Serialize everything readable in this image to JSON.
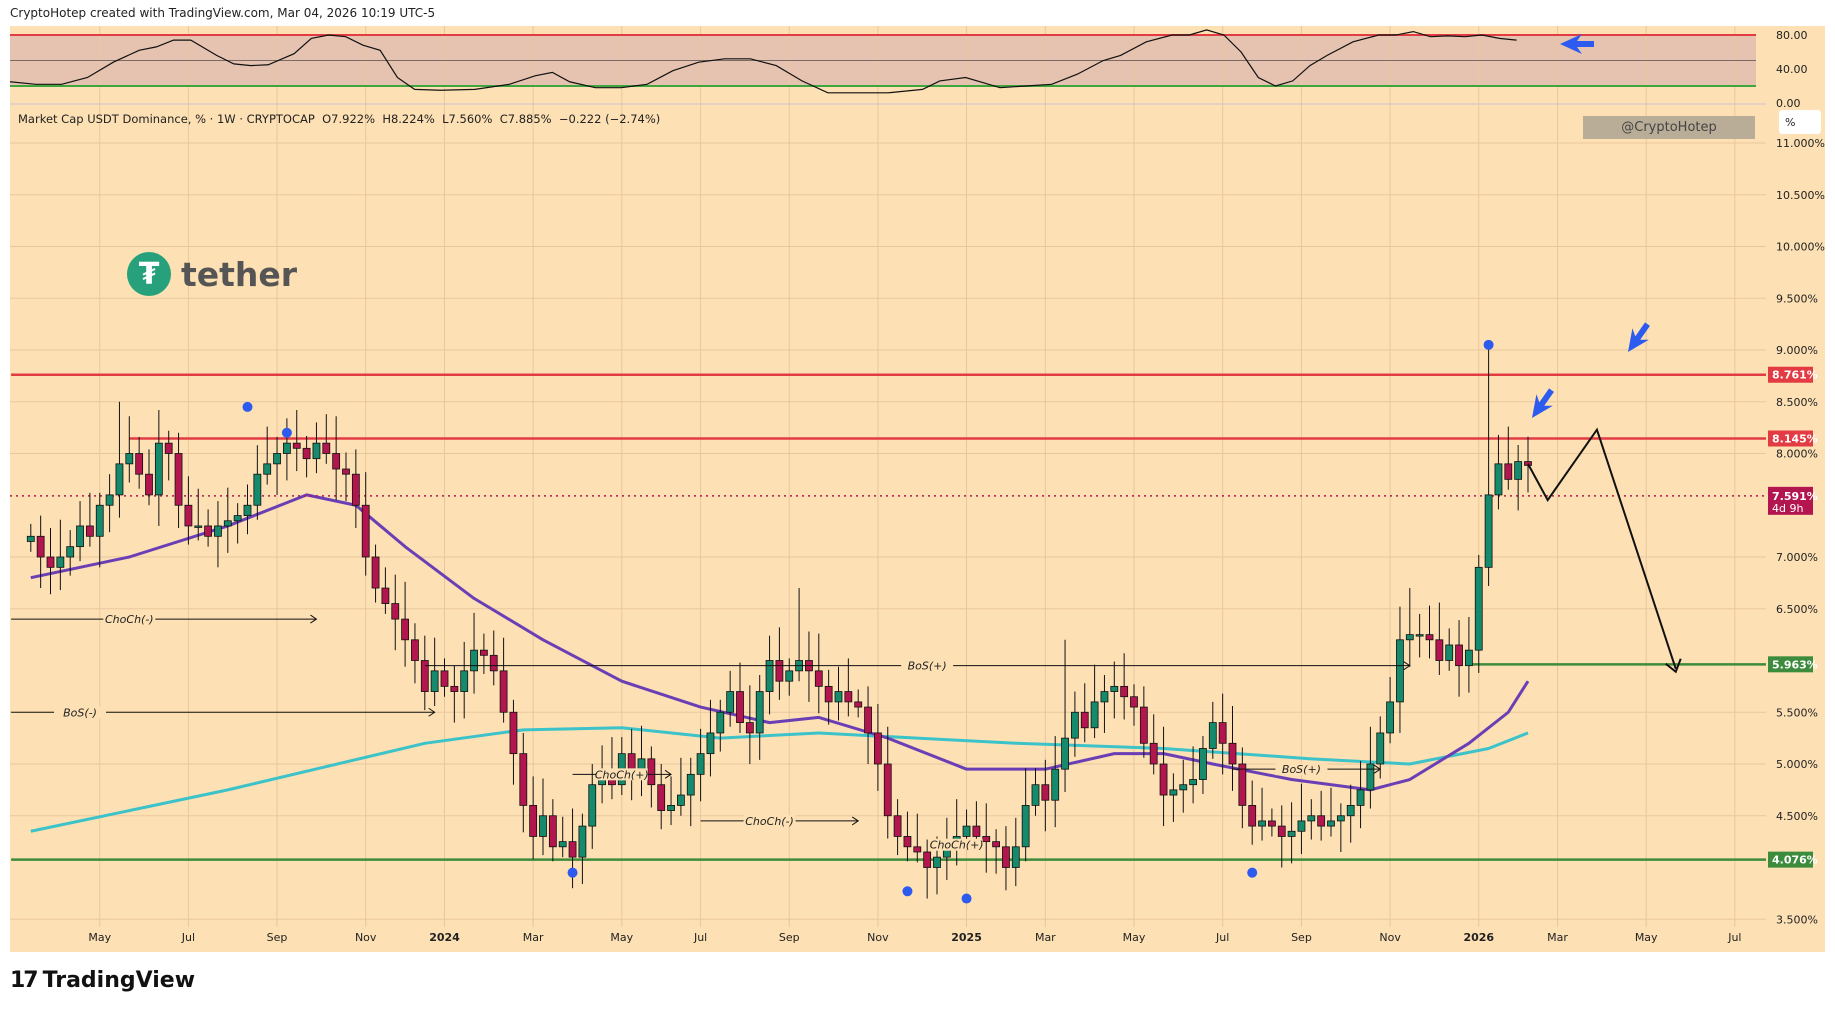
{
  "header": {
    "credit": "CryptoHotep created with TradingView.com, Mar 04, 2026 10:19 UTC-5"
  },
  "legend": {
    "text": "Market Cap USDT Dominance, % · 1W · CRYPTOCAP  O7.922%  H8.224%  L7.560%  C7.885%  −0.222 (−2.74%)"
  },
  "watermark": "@CryptoHotep",
  "unit_label": "%",
  "logo": {
    "coin": "₮",
    "word": "tether"
  },
  "footer": {
    "brand": "TradingView",
    "mark": "17"
  },
  "colors": {
    "bg": "#fde0b4",
    "up": "#168a6c",
    "down": "#b3164f",
    "ma_fast": "#6a3fb5",
    "ma_slow": "#3cc3c9",
    "resist": "#e23b44",
    "support": "#3d8b3d",
    "marker": "#2d5bf0"
  },
  "chart_data": {
    "type": "candlestick",
    "title": "Market Cap USDT Dominance, % · 1W · CRYPTOCAP",
    "xlabel": "",
    "ylabel": "%",
    "ylim": [
      3.5,
      11.0
    ],
    "y_ticks": [
      "11.000%",
      "10.500%",
      "10.000%",
      "9.500%",
      "9.000%",
      "8.500%",
      "8.000%",
      "7.000%",
      "6.500%",
      "5.500%",
      "5.000%",
      "4.500%",
      "3.500%"
    ],
    "y_tick_values": [
      11,
      10.5,
      10,
      9.5,
      9,
      8.5,
      8,
      7,
      6.5,
      5.5,
      5,
      4.5,
      3.5
    ],
    "x_ticks": [
      {
        "label": "May",
        "week": 7
      },
      {
        "label": "Jul",
        "week": 16
      },
      {
        "label": "Sep",
        "week": 25
      },
      {
        "label": "Nov",
        "week": 34
      },
      {
        "label": "2024",
        "week": 42
      },
      {
        "label": "Mar",
        "week": 51
      },
      {
        "label": "May",
        "week": 60
      },
      {
        "label": "Jul",
        "week": 68
      },
      {
        "label": "Sep",
        "week": 77
      },
      {
        "label": "Nov",
        "week": 86
      },
      {
        "label": "2025",
        "week": 95
      },
      {
        "label": "Mar",
        "week": 103
      },
      {
        "label": "May",
        "week": 112
      },
      {
        "label": "Jul",
        "week": 121
      },
      {
        "label": "Sep",
        "week": 129
      },
      {
        "label": "Nov",
        "week": 138
      },
      {
        "label": "2026",
        "week": 147
      },
      {
        "label": "Mar",
        "week": 155
      },
      {
        "label": "May",
        "week": 164
      },
      {
        "label": "Jul",
        "week": 173
      }
    ],
    "first_open": 7.15,
    "closes": [
      7.2,
      7.0,
      6.9,
      7.0,
      7.1,
      7.3,
      7.2,
      7.5,
      7.6,
      7.9,
      8.0,
      7.8,
      7.6,
      8.1,
      8.0,
      7.5,
      7.3,
      7.3,
      7.2,
      7.3,
      7.35,
      7.4,
      7.5,
      7.8,
      7.9,
      8.0,
      8.1,
      8.05,
      7.95,
      8.1,
      8.0,
      7.85,
      7.8,
      7.5,
      7.0,
      6.7,
      6.55,
      6.4,
      6.2,
      6.0,
      5.7,
      5.9,
      5.75,
      5.7,
      5.9,
      6.1,
      6.05,
      5.9,
      5.5,
      5.1,
      4.6,
      4.3,
      4.5,
      4.2,
      4.25,
      4.1,
      4.4,
      4.8,
      4.9,
      4.8,
      5.1,
      4.95,
      5.05,
      4.8,
      4.55,
      4.6,
      4.7,
      4.9,
      5.1,
      5.3,
      5.5,
      5.7,
      5.4,
      5.3,
      5.7,
      6.0,
      5.8,
      5.9,
      6.0,
      5.9,
      5.75,
      5.6,
      5.7,
      5.6,
      5.55,
      5.3,
      5.0,
      4.5,
      4.3,
      4.2,
      4.15,
      4.0,
      4.1,
      4.2,
      4.3,
      4.4,
      4.3,
      4.25,
      4.2,
      4.0,
      4.2,
      4.6,
      4.8,
      4.65,
      4.95,
      5.25,
      5.5,
      5.35,
      5.6,
      5.7,
      5.75,
      5.65,
      5.55,
      5.2,
      5.0,
      4.7,
      4.75,
      4.8,
      4.85,
      5.15,
      5.4,
      5.2,
      5.0,
      4.6,
      4.4,
      4.45,
      4.4,
      4.3,
      4.35,
      4.45,
      4.5,
      4.4,
      4.45,
      4.5,
      4.6,
      4.75,
      5.0,
      5.3,
      5.6,
      6.2,
      6.25,
      6.25,
      6.2,
      6.0,
      6.15,
      5.95,
      6.1,
      6.9,
      7.6,
      7.9,
      7.75,
      7.922,
      7.885
    ],
    "spikes": [
      {
        "week": 148,
        "high": 9.05
      },
      {
        "week": 9,
        "high": 8.5
      },
      {
        "week": 78,
        "high": 6.7
      },
      {
        "week": 105,
        "high": 6.2
      },
      {
        "week": 140,
        "high": 6.7
      }
    ],
    "ma_fast": [
      [
        0,
        6.8
      ],
      [
        10,
        7.0
      ],
      [
        20,
        7.3
      ],
      [
        28,
        7.6
      ],
      [
        33,
        7.5
      ],
      [
        38,
        7.1
      ],
      [
        45,
        6.6
      ],
      [
        52,
        6.2
      ],
      [
        60,
        5.8
      ],
      [
        68,
        5.55
      ],
      [
        75,
        5.4
      ],
      [
        80,
        5.45
      ],
      [
        87,
        5.25
      ],
      [
        95,
        4.95
      ],
      [
        103,
        4.95
      ],
      [
        110,
        5.1
      ],
      [
        115,
        5.1
      ],
      [
        120,
        5.0
      ],
      [
        128,
        4.85
      ],
      [
        136,
        4.75
      ],
      [
        140,
        4.85
      ],
      [
        146,
        5.2
      ],
      [
        150,
        5.5
      ],
      [
        152,
        5.8
      ]
    ],
    "ma_slow": [
      [
        0,
        4.35
      ],
      [
        20,
        4.75
      ],
      [
        40,
        5.2
      ],
      [
        50,
        5.33
      ],
      [
        60,
        5.35
      ],
      [
        70,
        5.25
      ],
      [
        80,
        5.3
      ],
      [
        90,
        5.25
      ],
      [
        100,
        5.2
      ],
      [
        115,
        5.15
      ],
      [
        130,
        5.05
      ],
      [
        140,
        5.0
      ],
      [
        148,
        5.15
      ],
      [
        152,
        5.3
      ]
    ],
    "levels": [
      {
        "value": 8.761,
        "label": "8.761%",
        "kind": "resist",
        "from_week": -2
      },
      {
        "value": 8.145,
        "label": "8.145%",
        "kind": "resist",
        "from_week": 10
      },
      {
        "value": 5.963,
        "label": "5.963%",
        "kind": "support",
        "from_week": 146
      },
      {
        "value": 4.076,
        "label": "4.076%",
        "kind": "support",
        "from_week": -2
      }
    ],
    "last_price": {
      "value": 7.591,
      "label": "7.591%",
      "countdown": "4d 9h"
    },
    "annotations": [
      {
        "text": "ChoCh(-)",
        "value": 6.4,
        "from": -2,
        "to": 29,
        "label_at": 10
      },
      {
        "text": "BoS(-)",
        "value": 5.5,
        "from": -2,
        "to": 41,
        "label_at": 5
      },
      {
        "text": "BoS(+)",
        "value": 5.95,
        "from": 40,
        "to": 140,
        "label_at": 91
      },
      {
        "text": "ChoCh(+)",
        "value": 4.9,
        "from": 55,
        "to": 65,
        "label_at": 60
      },
      {
        "text": "ChoCh(-)",
        "value": 4.45,
        "from": 68,
        "to": 84,
        "label_at": 75
      },
      {
        "text": "ChoCh(+)",
        "value": 4.22,
        "from": 93,
        "to": 96,
        "label_at": 94
      },
      {
        "text": "BoS(+)",
        "value": 4.95,
        "from": 122,
        "to": 137,
        "label_at": 129
      }
    ],
    "pivot_markers": [
      {
        "week": 22,
        "value": 8.45
      },
      {
        "week": 26,
        "value": 8.2
      },
      {
        "week": 55,
        "value": 3.95
      },
      {
        "week": 89,
        "value": 3.77
      },
      {
        "week": 95,
        "value": 3.7
      },
      {
        "week": 124,
        "value": 3.95
      },
      {
        "week": 148,
        "value": 9.05
      }
    ],
    "projection": [
      [
        152,
        7.9
      ],
      [
        154,
        7.55
      ],
      [
        159,
        8.23
      ],
      [
        167,
        5.92
      ]
    ],
    "oscillator": {
      "ylim": [
        0,
        100
      ],
      "upper": 80,
      "lower": 20,
      "mid": 50,
      "ticks": [
        "80.00",
        "40.00",
        "0.00"
      ],
      "tick_values": [
        80,
        40,
        0
      ],
      "values": [
        [
          0,
          25
        ],
        [
          3,
          22
        ],
        [
          6,
          22
        ],
        [
          9,
          30
        ],
        [
          12,
          48
        ],
        [
          15,
          62
        ],
        [
          17,
          66
        ],
        [
          19,
          74
        ],
        [
          21,
          74
        ],
        [
          24,
          56
        ],
        [
          26,
          46
        ],
        [
          28,
          44
        ],
        [
          30,
          45
        ],
        [
          33,
          58
        ],
        [
          35,
          76
        ],
        [
          37,
          80
        ],
        [
          39,
          78
        ],
        [
          41,
          68
        ],
        [
          43,
          62
        ],
        [
          45,
          30
        ],
        [
          47,
          16
        ],
        [
          50,
          15
        ],
        [
          54,
          16
        ],
        [
          58,
          22
        ],
        [
          61,
          32
        ],
        [
          63,
          36
        ],
        [
          65,
          25
        ],
        [
          68,
          18
        ],
        [
          71,
          18
        ],
        [
          74,
          22
        ],
        [
          77,
          38
        ],
        [
          80,
          48
        ],
        [
          83,
          52
        ],
        [
          86,
          52
        ],
        [
          89,
          44
        ],
        [
          92,
          26
        ],
        [
          95,
          12
        ],
        [
          98,
          12
        ],
        [
          102,
          12
        ],
        [
          106,
          16
        ],
        [
          108,
          26
        ],
        [
          111,
          30
        ],
        [
          113,
          24
        ],
        [
          115,
          18
        ],
        [
          118,
          20
        ],
        [
          121,
          22
        ],
        [
          124,
          34
        ],
        [
          127,
          50
        ],
        [
          129,
          56
        ],
        [
          132,
          72
        ],
        [
          135,
          80
        ],
        [
          137,
          80
        ],
        [
          139,
          86
        ],
        [
          141,
          80
        ],
        [
          143,
          60
        ],
        [
          145,
          30
        ],
        [
          147,
          20
        ],
        [
          149,
          26
        ],
        [
          151,
          44
        ],
        [
          153,
          56
        ],
        [
          156,
          72
        ],
        [
          159,
          80
        ],
        [
          161,
          80
        ],
        [
          163,
          84
        ],
        [
          165,
          78
        ],
        [
          167,
          79
        ],
        [
          169,
          78
        ],
        [
          171,
          80
        ],
        [
          173,
          76
        ],
        [
          175,
          74
        ]
      ],
      "oscillator_week_scale": 0.874
    }
  }
}
